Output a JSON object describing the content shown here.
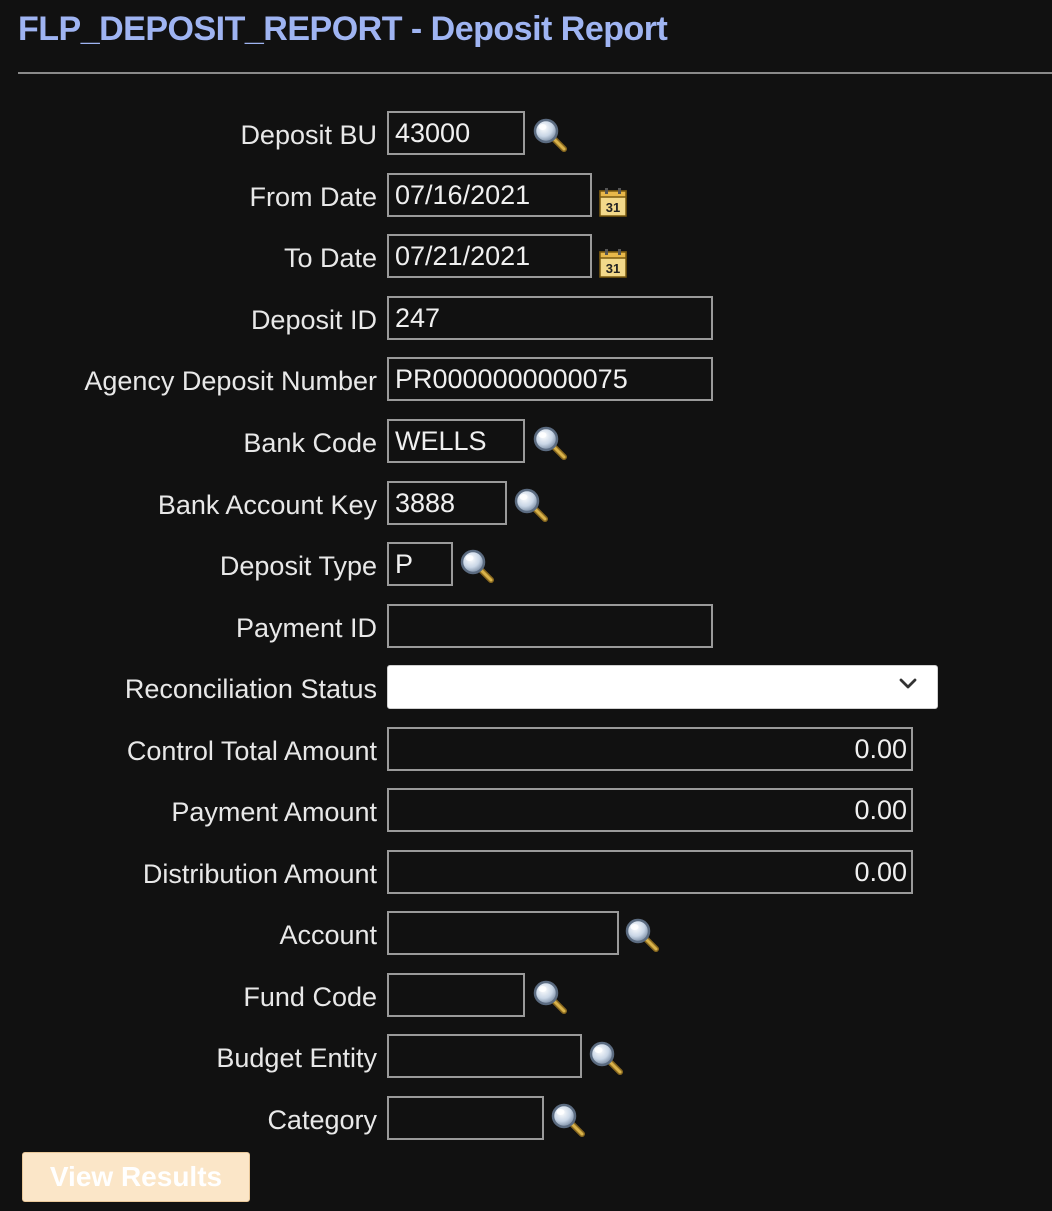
{
  "header": {
    "title": "FLP_DEPOSIT_REPORT - Deposit Report"
  },
  "form": {
    "deposit_bu": {
      "label": "Deposit BU",
      "value": "43000"
    },
    "from_date": {
      "label": "From Date",
      "value": "07/16/2021"
    },
    "to_date": {
      "label": "To Date",
      "value": "07/21/2021"
    },
    "deposit_id": {
      "label": "Deposit ID",
      "value": "247"
    },
    "agency_deposit_number": {
      "label": "Agency Deposit Number",
      "value": "PR0000000000075"
    },
    "bank_code": {
      "label": "Bank Code",
      "value": "WELLS"
    },
    "bank_account_key": {
      "label": "Bank Account Key",
      "value": "3888"
    },
    "deposit_type": {
      "label": "Deposit Type",
      "value": "P"
    },
    "payment_id": {
      "label": "Payment ID",
      "value": ""
    },
    "reconciliation_status": {
      "label": "Reconciliation Status",
      "value": ""
    },
    "control_total_amount": {
      "label": "Control Total Amount",
      "value": "0.00"
    },
    "payment_amount": {
      "label": "Payment Amount",
      "value": "0.00"
    },
    "distribution_amount": {
      "label": "Distribution Amount",
      "value": "0.00"
    },
    "account": {
      "label": "Account",
      "value": ""
    },
    "fund_code": {
      "label": "Fund Code",
      "value": ""
    },
    "budget_entity": {
      "label": "Budget Entity",
      "value": ""
    },
    "category": {
      "label": "Category",
      "value": ""
    }
  },
  "icons": {
    "lookup": "magnifier-icon",
    "calendar": "calendar-icon",
    "calendar_day": "31",
    "select_arrow": "chevron-down-icon"
  },
  "actions": {
    "view_results_label": "View Results"
  },
  "colors": {
    "background": "#111111",
    "title": "#9fb4f2",
    "button": "#fbe6c8"
  }
}
